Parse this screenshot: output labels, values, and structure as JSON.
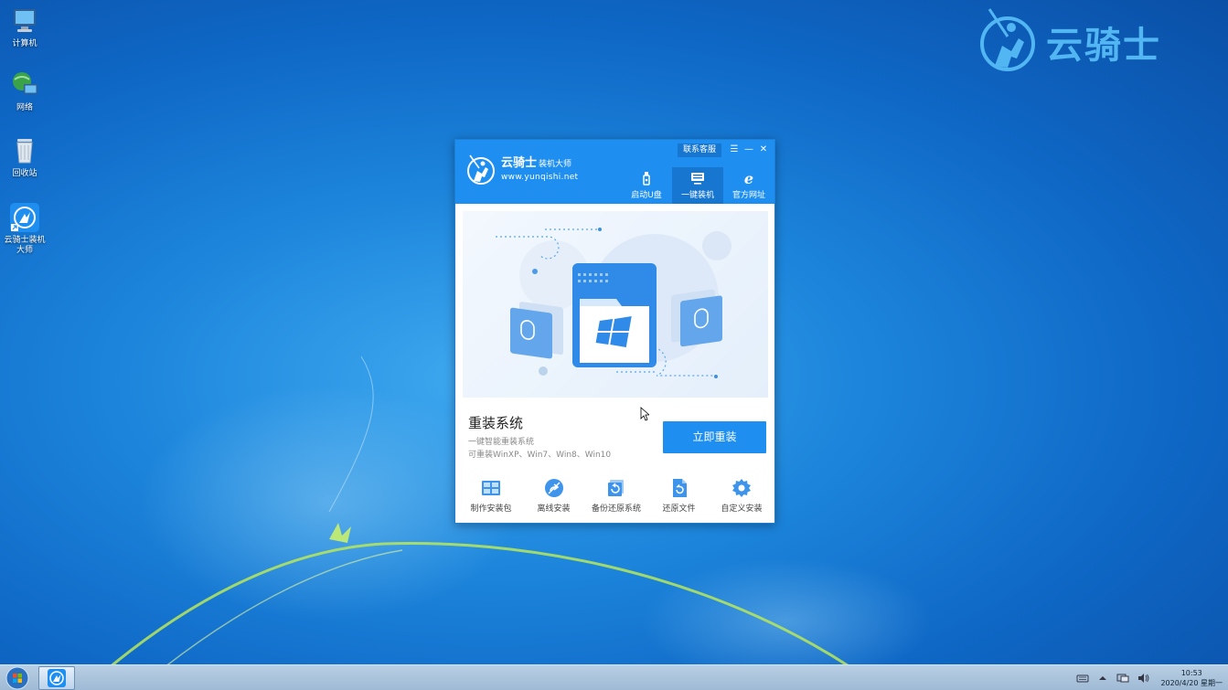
{
  "desktop": {
    "icons": [
      {
        "label": "计算机"
      },
      {
        "label": "网络"
      },
      {
        "label": "回收站"
      },
      {
        "label": "云骑士装机大师"
      }
    ]
  },
  "brand": {
    "text": "云骑士"
  },
  "app": {
    "logo_title": "云骑士",
    "logo_subtitle": "装机大师",
    "logo_url": "www.yunqishi.net",
    "contact_label": "联系客服",
    "tabs": [
      {
        "label": "启动U盘",
        "icon": "usb-icon"
      },
      {
        "label": "一键装机",
        "icon": "monitor-icon",
        "active": true
      },
      {
        "label": "官方网址",
        "icon": "browser-icon"
      }
    ],
    "reinstall": {
      "title": "重装系统",
      "line1": "一键智能重装系统",
      "line2": "可重装WinXP、Win7、Win8、Win10",
      "button": "立即重装"
    },
    "tools": [
      {
        "label": "制作安装包",
        "icon": "package-icon"
      },
      {
        "label": "离线安装",
        "icon": "offline-icon"
      },
      {
        "label": "备份还原系统",
        "icon": "backup-icon"
      },
      {
        "label": "还原文件",
        "icon": "restore-file-icon"
      },
      {
        "label": "自定义安装",
        "icon": "custom-install-icon"
      }
    ]
  },
  "taskbar": {
    "time": "10:53",
    "date": "2020/4/20 星期一"
  },
  "colors": {
    "accent": "#1e8ff0",
    "accent_dark": "#1776cf"
  }
}
